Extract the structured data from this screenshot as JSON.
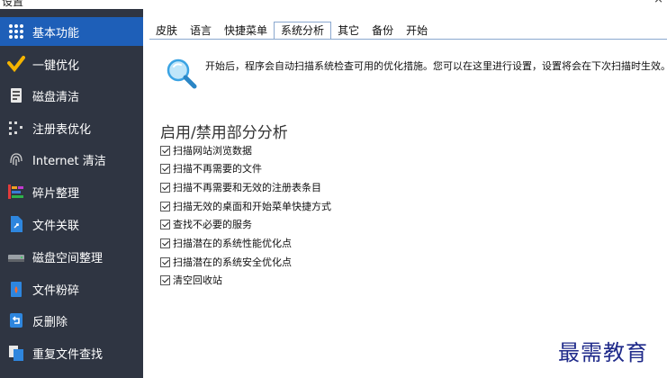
{
  "window": {
    "title": "设置",
    "close_glyph": "×"
  },
  "sidebar": {
    "items": [
      {
        "label": "基本功能",
        "icon": "grid-dots-icon",
        "active": true
      },
      {
        "label": "一键优化",
        "icon": "broom-check-icon"
      },
      {
        "label": "磁盘清洁",
        "icon": "disk-clean-icon"
      },
      {
        "label": "注册表优化",
        "icon": "registry-dots-icon"
      },
      {
        "label": "Internet 清洁",
        "icon": "fingerprint-icon"
      },
      {
        "label": "碎片整理",
        "icon": "defrag-blocks-icon"
      },
      {
        "label": "文件关联",
        "icon": "file-link-icon"
      },
      {
        "label": "磁盘空间整理",
        "icon": "hard-drive-icon"
      },
      {
        "label": "文件粉碎",
        "icon": "shredder-icon"
      },
      {
        "label": "反删除",
        "icon": "undelete-icon"
      },
      {
        "label": "重复文件查找",
        "icon": "duplicate-files-icon"
      }
    ]
  },
  "tabs": [
    {
      "label": "皮肤"
    },
    {
      "label": "语言"
    },
    {
      "label": "快捷菜单"
    },
    {
      "label": "系统分析",
      "active": true
    },
    {
      "label": "其它"
    },
    {
      "label": "备份"
    },
    {
      "label": "开始"
    }
  ],
  "info": {
    "icon": "magnifier-icon",
    "text": "开始后，程序会自动扫描系统检查可用的优化措施。您可以在这里进行设置，设置将会在下次扫描时生效。"
  },
  "section": {
    "title": "启用/禁用部分分析",
    "options": [
      {
        "label": "扫描网站浏览数据",
        "checked": true
      },
      {
        "label": "扫描不再需要的文件",
        "checked": true
      },
      {
        "label": "扫描不再需要和无效的注册表条目",
        "checked": true
      },
      {
        "label": "扫描无效的桌面和开始菜单快捷方式",
        "checked": true
      },
      {
        "label": "查找不必要的服务",
        "checked": true
      },
      {
        "label": "扫描潜在的系统性能优化点",
        "checked": true
      },
      {
        "label": "扫描潜在的系统安全优化点",
        "checked": true
      },
      {
        "label": "清空回收站",
        "checked": true
      }
    ]
  },
  "watermark": "最需教育",
  "colors": {
    "sidebar_bg": "#2f3542",
    "active_bg": "#1e5fb8",
    "tab_border": "#8aa8cf",
    "watermark": "#1f2a8a"
  }
}
